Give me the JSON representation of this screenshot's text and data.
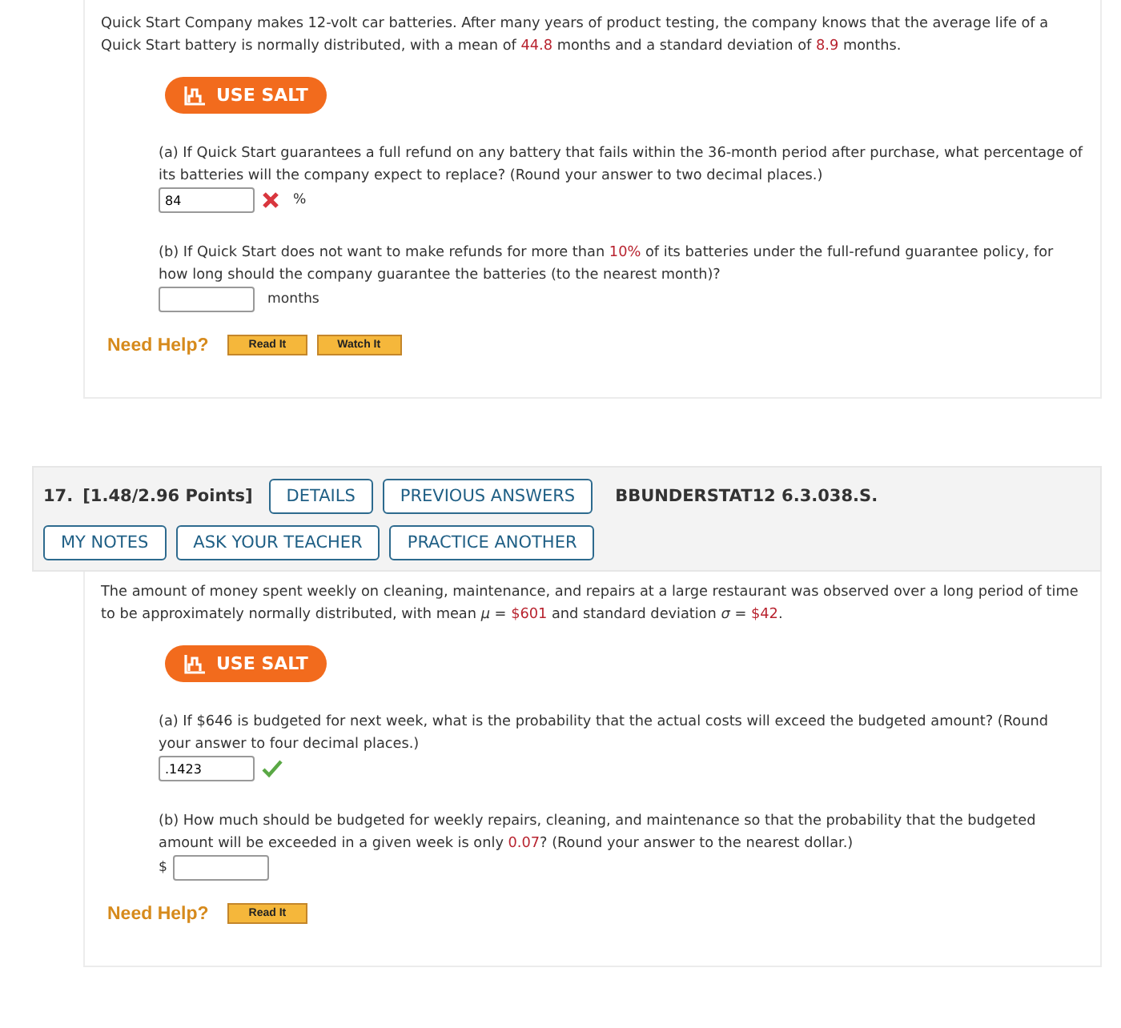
{
  "questions": [
    {
      "intro": [
        "Quick Start Company makes 12-volt car batteries. After many years of product testing, the company knows that the average life of a Quick Start battery is normally distributed, with a mean of ",
        {
          "text": "44.8",
          "highlight": true
        },
        " months and a standard deviation of ",
        {
          "text": "8.9",
          "highlight": true
        },
        " months."
      ],
      "salt_button": "USE SALT",
      "parts": [
        {
          "prompt": [
            "(a) If Quick Start guarantees a full refund on any battery that fails within the 36-month period after purchase, what percentage of its batteries will the company expect to replace? (Round your answer to two decimal places.)"
          ],
          "value": "84",
          "correct": false,
          "unit": "%"
        },
        {
          "prompt": [
            "(b) If Quick Start does not want to make refunds for more than ",
            {
              "text": "10%",
              "highlight": true
            },
            " of its batteries under the full-refund guarantee policy, for how long should the company guarantee the batteries (to the nearest month)?"
          ],
          "unit": "months"
        }
      ],
      "help_label": "Need Help?",
      "help_buttons": [
        "Read It",
        "Watch It"
      ]
    },
    {
      "header": {
        "number": "17.",
        "points": "[1.48/2.96 Points]",
        "buttons": [
          "DETAILS",
          "PREVIOUS ANSWERS"
        ],
        "code": "BBUNDERSTAT12 6.3.038.S.",
        "buttons_row2": [
          "MY NOTES",
          "ASK YOUR TEACHER",
          "PRACTICE ANOTHER"
        ]
      },
      "intro": [
        "The amount of money spent weekly on cleaning, maintenance, and repairs at a large restaurant was observed over a long period of time to be approximately normally distributed, with mean *μ* = ",
        {
          "text": "$601",
          "highlight": true
        },
        " and standard deviation *σ* = ",
        {
          "text": "$42",
          "highlight": true
        },
        "."
      ],
      "salt_button": "USE SALT",
      "parts": [
        {
          "prompt": [
            "(a) If $646 is budgeted for next week, what is the probability that the actual costs will exceed the budgeted amount? (Round your answer to four decimal places.)"
          ],
          "value": ".1423",
          "correct": true
        },
        {
          "prompt": [
            "(b) How much should be budgeted for weekly repairs, cleaning, and maintenance so that the probability that the budgeted amount will be exceeded in a given week is only ",
            {
              "text": "0.07",
              "highlight": true
            },
            "? (Round your answer to the nearest dollar.)"
          ],
          "prefix": "$"
        }
      ],
      "help_label": "Need Help?",
      "help_buttons": [
        "Read It"
      ]
    }
  ]
}
